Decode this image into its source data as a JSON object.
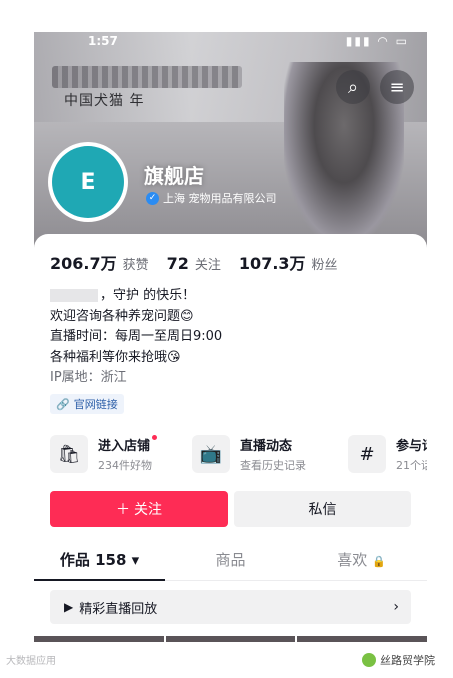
{
  "status_bar": {
    "time": "1:57",
    "icons": "▮▮▮ ◠ ▭"
  },
  "banner": {
    "subtitle": "中国犬猫  年",
    "shop_name": "旗舰店",
    "verify_text": "上海  宠物用品有限公司"
  },
  "avatar": {
    "text": "E"
  },
  "stats": [
    {
      "num": "206.7万",
      "label": "获赞"
    },
    {
      "num": "72",
      "label": "关注"
    },
    {
      "num": "107.3万",
      "label": "粉丝"
    }
  ],
  "bio": {
    "line1": "，守护  的快乐！",
    "line2": "欢迎咨询各种养宠问题😊",
    "line3": "直播时间：每周一至周日9:00",
    "line4": "各种福利等你来抢哦😘",
    "ip": "IP属地：浙江"
  },
  "link_chip": "官网链接",
  "features": [
    {
      "icon": "shop-bag-icon",
      "title": "进入店铺",
      "sub": "234件好物"
    },
    {
      "icon": "live-tv-icon",
      "title": "直播动态",
      "sub": "查看历史记录"
    },
    {
      "icon": "hashtag-icon",
      "title": "参与话",
      "sub": "21个话"
    }
  ],
  "buttons": {
    "follow": "关注",
    "message": "私信"
  },
  "tabs": [
    {
      "label": "作品 158 ▾"
    },
    {
      "label": "商品"
    },
    {
      "label": "喜欢"
    }
  ],
  "replay": {
    "label": "精彩直播回放"
  },
  "watermark_left": "大数据应用",
  "watermark_right": "丝路贸学院",
  "colors": {
    "accent": "#fe2c55",
    "avatar_bg": "#1fa8b4",
    "verify": "#2b8cf2"
  }
}
